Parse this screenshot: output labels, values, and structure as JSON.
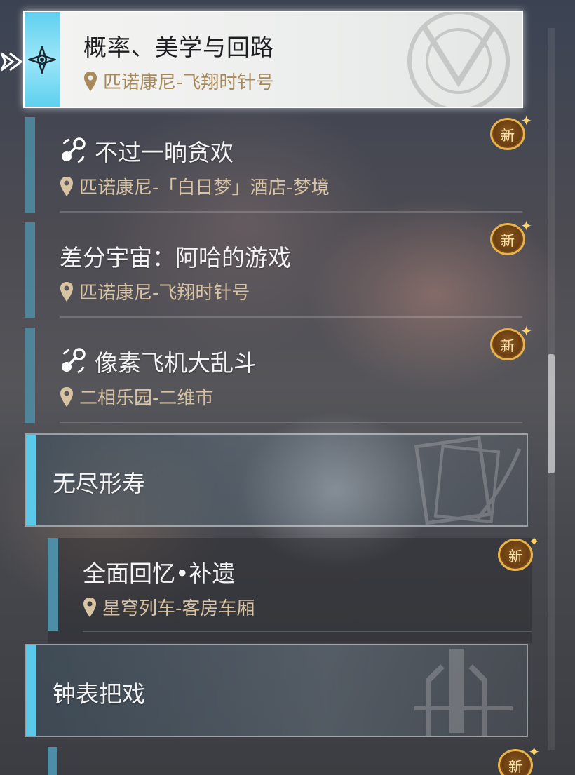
{
  "selected": {
    "title": "概率、美学与回路",
    "location": "匹诺康尼-飞翔时针号"
  },
  "items": [
    {
      "title": "不过一晌贪欢",
      "location": "匹诺康尼-「白日梦」酒店-梦境",
      "badge": "新",
      "icon": "quest-icon"
    },
    {
      "title": "差分宇宙：阿哈的游戏",
      "location": "匹诺康尼-飞翔时针号",
      "badge": "新"
    },
    {
      "title": "像素飞机大乱斗",
      "location": "二相乐园-二维市",
      "badge": "新",
      "icon": "quest-icon"
    }
  ],
  "categories": [
    {
      "title": "无尽形寿"
    },
    {
      "title": "钟表把戏"
    }
  ],
  "sub_items": [
    {
      "title": "全面回忆•补遗",
      "location": "星穹列车-客房车厢",
      "badge": "新"
    }
  ],
  "partial_badge": "新",
  "colors": {
    "accent_cyan": "#5bc9ea",
    "location_gold": "#d8c3a3",
    "badge_gold": "#e8b34c"
  }
}
